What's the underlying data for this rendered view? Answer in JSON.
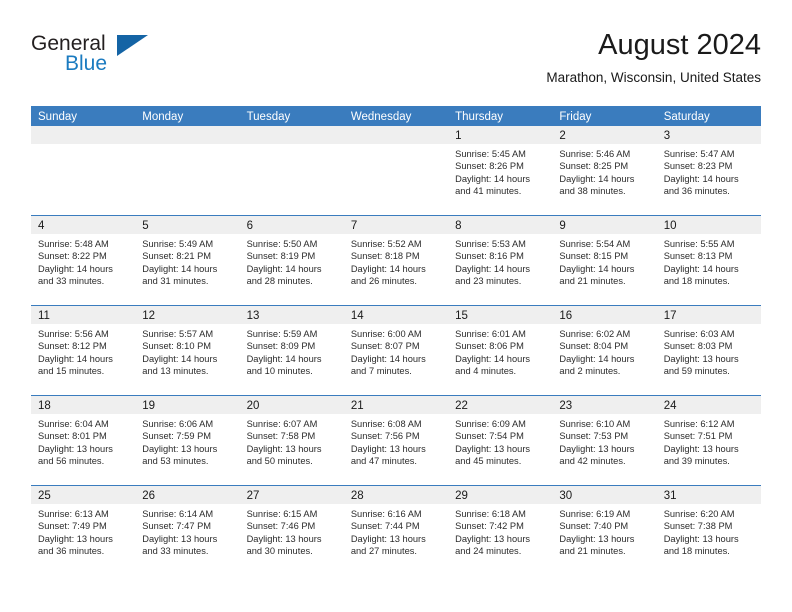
{
  "brand": {
    "name_part1": "General",
    "name_part2": "Blue",
    "triangle_color": "#1464a5",
    "blue_color": "#1b7bc0"
  },
  "header": {
    "month_title": "August 2024",
    "location": "Marathon, Wisconsin, United States"
  },
  "theme": {
    "header_row_bg": "#3a7cbe",
    "date_band_bg": "#efefef",
    "text_color": "#1a1a1a"
  },
  "weekdays": [
    "Sunday",
    "Monday",
    "Tuesday",
    "Wednesday",
    "Thursday",
    "Friday",
    "Saturday"
  ],
  "labels": {
    "sunrise": "Sunrise:",
    "sunset": "Sunset:",
    "daylight": "Daylight:"
  },
  "weeks": [
    [
      {
        "date": "",
        "empty": true
      },
      {
        "date": "",
        "empty": true
      },
      {
        "date": "",
        "empty": true
      },
      {
        "date": "",
        "empty": true
      },
      {
        "date": "1",
        "sunrise": "Sunrise: 5:45 AM",
        "sunset": "Sunset: 8:26 PM",
        "daylight": "Daylight: 14 hours and 41 minutes."
      },
      {
        "date": "2",
        "sunrise": "Sunrise: 5:46 AM",
        "sunset": "Sunset: 8:25 PM",
        "daylight": "Daylight: 14 hours and 38 minutes."
      },
      {
        "date": "3",
        "sunrise": "Sunrise: 5:47 AM",
        "sunset": "Sunset: 8:23 PM",
        "daylight": "Daylight: 14 hours and 36 minutes."
      }
    ],
    [
      {
        "date": "4",
        "sunrise": "Sunrise: 5:48 AM",
        "sunset": "Sunset: 8:22 PM",
        "daylight": "Daylight: 14 hours and 33 minutes."
      },
      {
        "date": "5",
        "sunrise": "Sunrise: 5:49 AM",
        "sunset": "Sunset: 8:21 PM",
        "daylight": "Daylight: 14 hours and 31 minutes."
      },
      {
        "date": "6",
        "sunrise": "Sunrise: 5:50 AM",
        "sunset": "Sunset: 8:19 PM",
        "daylight": "Daylight: 14 hours and 28 minutes."
      },
      {
        "date": "7",
        "sunrise": "Sunrise: 5:52 AM",
        "sunset": "Sunset: 8:18 PM",
        "daylight": "Daylight: 14 hours and 26 minutes."
      },
      {
        "date": "8",
        "sunrise": "Sunrise: 5:53 AM",
        "sunset": "Sunset: 8:16 PM",
        "daylight": "Daylight: 14 hours and 23 minutes."
      },
      {
        "date": "9",
        "sunrise": "Sunrise: 5:54 AM",
        "sunset": "Sunset: 8:15 PM",
        "daylight": "Daylight: 14 hours and 21 minutes."
      },
      {
        "date": "10",
        "sunrise": "Sunrise: 5:55 AM",
        "sunset": "Sunset: 8:13 PM",
        "daylight": "Daylight: 14 hours and 18 minutes."
      }
    ],
    [
      {
        "date": "11",
        "sunrise": "Sunrise: 5:56 AM",
        "sunset": "Sunset: 8:12 PM",
        "daylight": "Daylight: 14 hours and 15 minutes."
      },
      {
        "date": "12",
        "sunrise": "Sunrise: 5:57 AM",
        "sunset": "Sunset: 8:10 PM",
        "daylight": "Daylight: 14 hours and 13 minutes."
      },
      {
        "date": "13",
        "sunrise": "Sunrise: 5:59 AM",
        "sunset": "Sunset: 8:09 PM",
        "daylight": "Daylight: 14 hours and 10 minutes."
      },
      {
        "date": "14",
        "sunrise": "Sunrise: 6:00 AM",
        "sunset": "Sunset: 8:07 PM",
        "daylight": "Daylight: 14 hours and 7 minutes."
      },
      {
        "date": "15",
        "sunrise": "Sunrise: 6:01 AM",
        "sunset": "Sunset: 8:06 PM",
        "daylight": "Daylight: 14 hours and 4 minutes."
      },
      {
        "date": "16",
        "sunrise": "Sunrise: 6:02 AM",
        "sunset": "Sunset: 8:04 PM",
        "daylight": "Daylight: 14 hours and 2 minutes."
      },
      {
        "date": "17",
        "sunrise": "Sunrise: 6:03 AM",
        "sunset": "Sunset: 8:03 PM",
        "daylight": "Daylight: 13 hours and 59 minutes."
      }
    ],
    [
      {
        "date": "18",
        "sunrise": "Sunrise: 6:04 AM",
        "sunset": "Sunset: 8:01 PM",
        "daylight": "Daylight: 13 hours and 56 minutes."
      },
      {
        "date": "19",
        "sunrise": "Sunrise: 6:06 AM",
        "sunset": "Sunset: 7:59 PM",
        "daylight": "Daylight: 13 hours and 53 minutes."
      },
      {
        "date": "20",
        "sunrise": "Sunrise: 6:07 AM",
        "sunset": "Sunset: 7:58 PM",
        "daylight": "Daylight: 13 hours and 50 minutes."
      },
      {
        "date": "21",
        "sunrise": "Sunrise: 6:08 AM",
        "sunset": "Sunset: 7:56 PM",
        "daylight": "Daylight: 13 hours and 47 minutes."
      },
      {
        "date": "22",
        "sunrise": "Sunrise: 6:09 AM",
        "sunset": "Sunset: 7:54 PM",
        "daylight": "Daylight: 13 hours and 45 minutes."
      },
      {
        "date": "23",
        "sunrise": "Sunrise: 6:10 AM",
        "sunset": "Sunset: 7:53 PM",
        "daylight": "Daylight: 13 hours and 42 minutes."
      },
      {
        "date": "24",
        "sunrise": "Sunrise: 6:12 AM",
        "sunset": "Sunset: 7:51 PM",
        "daylight": "Daylight: 13 hours and 39 minutes."
      }
    ],
    [
      {
        "date": "25",
        "sunrise": "Sunrise: 6:13 AM",
        "sunset": "Sunset: 7:49 PM",
        "daylight": "Daylight: 13 hours and 36 minutes."
      },
      {
        "date": "26",
        "sunrise": "Sunrise: 6:14 AM",
        "sunset": "Sunset: 7:47 PM",
        "daylight": "Daylight: 13 hours and 33 minutes."
      },
      {
        "date": "27",
        "sunrise": "Sunrise: 6:15 AM",
        "sunset": "Sunset: 7:46 PM",
        "daylight": "Daylight: 13 hours and 30 minutes."
      },
      {
        "date": "28",
        "sunrise": "Sunrise: 6:16 AM",
        "sunset": "Sunset: 7:44 PM",
        "daylight": "Daylight: 13 hours and 27 minutes."
      },
      {
        "date": "29",
        "sunrise": "Sunrise: 6:18 AM",
        "sunset": "Sunset: 7:42 PM",
        "daylight": "Daylight: 13 hours and 24 minutes."
      },
      {
        "date": "30",
        "sunrise": "Sunrise: 6:19 AM",
        "sunset": "Sunset: 7:40 PM",
        "daylight": "Daylight: 13 hours and 21 minutes."
      },
      {
        "date": "31",
        "sunrise": "Sunrise: 6:20 AM",
        "sunset": "Sunset: 7:38 PM",
        "daylight": "Daylight: 13 hours and 18 minutes."
      }
    ]
  ]
}
